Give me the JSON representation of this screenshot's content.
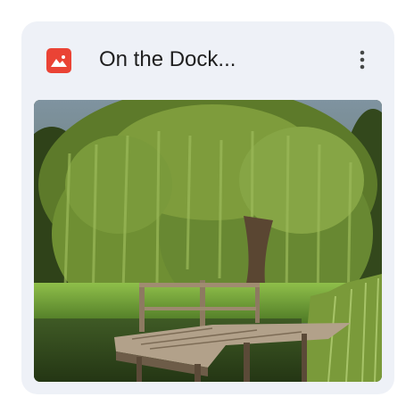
{
  "file_card": {
    "title": "On the Dock...",
    "file_type_icon": "image-file-icon",
    "menu_icon": "more-vert-icon",
    "preview_icon": "image-thumbnail",
    "colors": {
      "card_background": "#eef1f7",
      "file_type_icon": "#ea4335",
      "title_text": "#1f1f1f"
    }
  }
}
